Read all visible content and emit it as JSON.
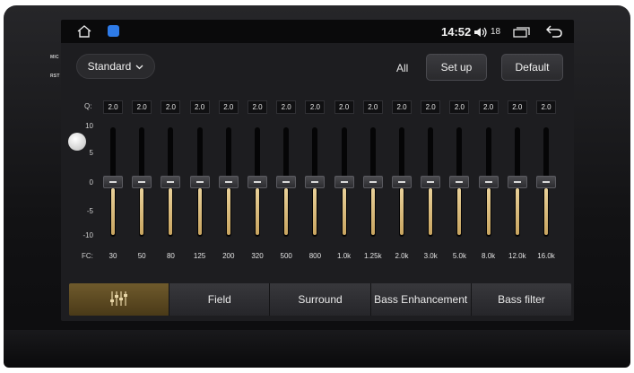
{
  "device": {
    "mic_label": "MIC",
    "rst_label": "RST"
  },
  "statusbar": {
    "time": "14:52",
    "volume": "18"
  },
  "toolbar": {
    "preset_label": "Standard",
    "all_label": "All",
    "setup_label": "Set up",
    "default_label": "Default"
  },
  "eq": {
    "q_label": "Q:",
    "fc_label": "FC:",
    "scale": [
      "10",
      "5",
      "0",
      "-5",
      "-10"
    ],
    "range": [
      -10,
      10
    ],
    "bands": [
      {
        "fc": "30",
        "q": "2.0",
        "gain": 0
      },
      {
        "fc": "50",
        "q": "2.0",
        "gain": 0
      },
      {
        "fc": "80",
        "q": "2.0",
        "gain": 0
      },
      {
        "fc": "125",
        "q": "2.0",
        "gain": 0
      },
      {
        "fc": "200",
        "q": "2.0",
        "gain": 0
      },
      {
        "fc": "320",
        "q": "2.0",
        "gain": 0
      },
      {
        "fc": "500",
        "q": "2.0",
        "gain": 0
      },
      {
        "fc": "800",
        "q": "2.0",
        "gain": 0
      },
      {
        "fc": "1.0k",
        "q": "2.0",
        "gain": 0
      },
      {
        "fc": "1.25k",
        "q": "2.0",
        "gain": 0
      },
      {
        "fc": "2.0k",
        "q": "2.0",
        "gain": 0
      },
      {
        "fc": "3.0k",
        "q": "2.0",
        "gain": 0
      },
      {
        "fc": "5.0k",
        "q": "2.0",
        "gain": 0
      },
      {
        "fc": "8.0k",
        "q": "2.0",
        "gain": 0
      },
      {
        "fc": "12.0k",
        "q": "2.0",
        "gain": 0
      },
      {
        "fc": "16.0k",
        "q": "2.0",
        "gain": 0
      }
    ]
  },
  "tabs": [
    {
      "label": "",
      "icon": "equalizer-icon",
      "active": true
    },
    {
      "label": "Field",
      "active": false
    },
    {
      "label": "Surround",
      "active": false
    },
    {
      "label": "Bass Enhancement",
      "active": false
    },
    {
      "label": "Bass filter",
      "active": false
    }
  ],
  "colors": {
    "accent": "#c9a560",
    "active_tab": "#5c4a22"
  }
}
